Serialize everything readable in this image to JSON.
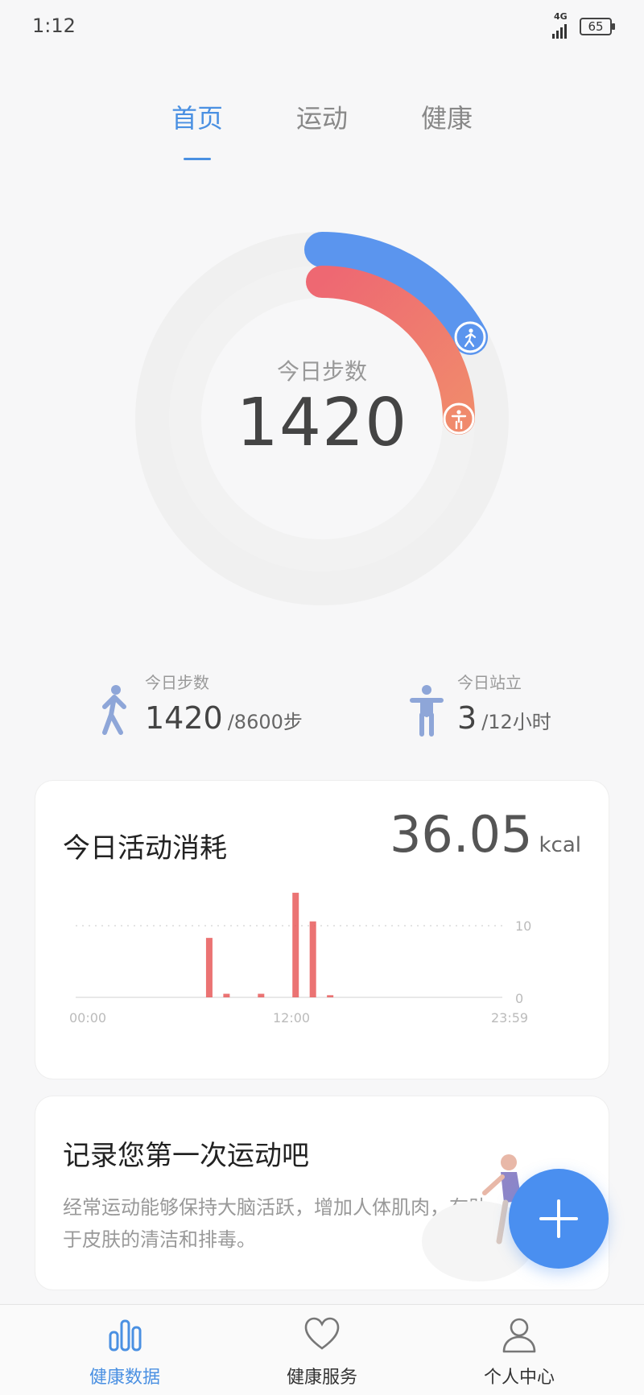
{
  "status_bar": {
    "time": "1:12",
    "network": "4G",
    "battery": "65"
  },
  "tabs": [
    {
      "label": "首页",
      "active": true
    },
    {
      "label": "运动",
      "active": false
    },
    {
      "label": "健康",
      "active": false
    }
  ],
  "ring": {
    "label": "今日步数",
    "value": "1420",
    "outer_progress": 0.17,
    "inner_progress": 0.25,
    "outer_icon": "walk-icon",
    "inner_icon": "stand-icon"
  },
  "stats": [
    {
      "label": "今日步数",
      "value": "1420",
      "suffix": "/8600步",
      "icon": "walking-person-icon"
    },
    {
      "label": "今日站立",
      "value": "3",
      "suffix": "/12小时",
      "icon": "standing-person-icon"
    }
  ],
  "activity_card": {
    "title": "今日活动消耗",
    "value": "36.05",
    "unit": "kcal"
  },
  "chart_data": {
    "type": "bar",
    "x_tick_labels": [
      "00:00",
      "12:00",
      "23:59"
    ],
    "y_tick_labels": [
      "10",
      "0"
    ],
    "ylim": [
      0,
      16
    ],
    "grid": true,
    "color": "#e85a5a",
    "hour_values": [
      0,
      0,
      0,
      0,
      0,
      0,
      0,
      8.3,
      0.5,
      0,
      0.5,
      0,
      14.6,
      10.6,
      0.3,
      0,
      0,
      0,
      0,
      0,
      0,
      0,
      0,
      0
    ]
  },
  "workout_card": {
    "title": "记录您第一次运动吧",
    "description": "经常运动能够保持大脑活跃，增加人体肌肉，有助于皮肤的清洁和排毒。"
  },
  "fab": {
    "icon": "plus-icon"
  },
  "bottom_nav": [
    {
      "label": "健康数据",
      "icon": "bar-chart-icon",
      "active": true
    },
    {
      "label": "健康服务",
      "icon": "heart-icon",
      "active": false
    },
    {
      "label": "个人中心",
      "icon": "person-icon",
      "active": false
    }
  ],
  "colors": {
    "accent": "#4a90e2",
    "ring_outer": "#5b95ee",
    "ring_inner_start": "#ee6872",
    "ring_inner_end": "#f08a6c",
    "bar": "#e85a5a"
  }
}
